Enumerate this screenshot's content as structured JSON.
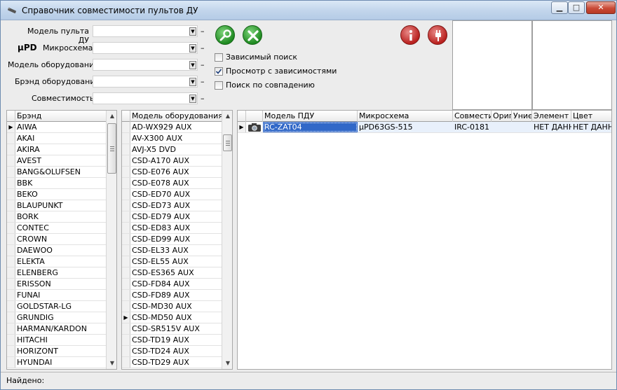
{
  "window": {
    "title": "Справочник совместимости пультов ДУ",
    "min_glyph": "▁",
    "max_glyph": "□",
    "close_glyph": "✕"
  },
  "filters": {
    "remote_model_label": "Модель пульта ДУ",
    "upd_badge": "µPD",
    "chip_label": "Микросхема",
    "equipment_model_label": "Модель оборудования",
    "equipment_brand_label": "Брэнд оборудования",
    "compatibility_label": "Совместимость",
    "dash": "–",
    "dropdown_arrow": "▼"
  },
  "options": {
    "dependent_search": {
      "label": "Зависимый поиск",
      "checked": false
    },
    "view_with_dependencies": {
      "label": "Просмотр с зависимостями",
      "checked": true
    },
    "match_search": {
      "label": "Поиск по совпадению",
      "checked": false
    }
  },
  "brands": {
    "header": "Брэнд",
    "selected_index": 0,
    "items": [
      "AIWA",
      "AKAI",
      "AKIRA",
      "AVEST",
      "BANG&OLUFSEN",
      "BBK",
      "BEKO",
      "BLAUPUNKT",
      "BORK",
      "CONTEC",
      "CROWN",
      "DAEWOO",
      "ELEKTA",
      "ELENBERG",
      "ERISSON",
      "FUNAI",
      "GOLDSTAR-LG",
      "GRUNDIG",
      "HARMAN/KARDON",
      "HITACHI",
      "HORIZONT",
      "HYUNDAI"
    ]
  },
  "models": {
    "header": "Модель оборудования",
    "selected_index": 17,
    "items": [
      "AD-WX929 AUX",
      "AV-X300 AUX",
      "AVJ-X5 DVD",
      "CSD-A170 AUX",
      "CSD-E076 AUX",
      "CSD-E078 AUX",
      "CSD-ED70 AUX",
      "CSD-ED73 AUX",
      "CSD-ED79 AUX",
      "CSD-ED83 AUX",
      "CSD-ED99 AUX",
      "CSD-EL33 AUX",
      "CSD-EL55 AUX",
      "CSD-ES365 AUX",
      "CSD-FD84 AUX",
      "CSD-FD89 AUX",
      "CSD-MD30 AUX",
      "CSD-MD50 AUX",
      "CSD-SR515V AUX",
      "CSD-TD19 AUX",
      "CSD-TD24 AUX",
      "CSD-TD29 AUX"
    ]
  },
  "results": {
    "headers": [
      "Модель ПДУ",
      "Микросхема",
      "Совмести",
      "Ориг",
      "Униє",
      "Элемент г",
      "Цвет"
    ],
    "rows": [
      {
        "remote": "RC-ZAT04",
        "chip": "µPD63GS-515",
        "compat": "IRC-0181",
        "orig": "",
        "univ": "",
        "element": "НЕТ ДАНН",
        "color": "НЕТ ДАНН"
      }
    ]
  },
  "status": {
    "label": "Найдено:"
  },
  "scroll": {
    "up": "▲",
    "down": "▼",
    "pointer": "▶"
  }
}
